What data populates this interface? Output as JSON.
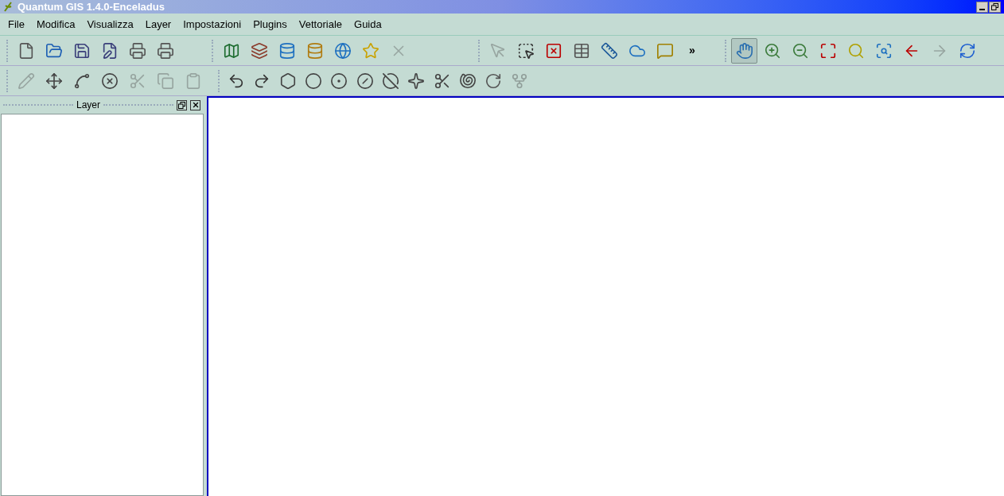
{
  "window": {
    "title": "Quantum GIS 1.4.0-Enceladus"
  },
  "menu": [
    "File",
    "Modifica",
    "Visualizza",
    "Layer",
    "Impostazioni",
    "Plugins",
    "Vettoriale",
    "Guida"
  ],
  "toolbars": [
    {
      "groups": [
        {
          "buttons": [
            {
              "disabled": false,
              "selected": false
            },
            {
              "disabled": false,
              "selected": false
            },
            {
              "disabled": false,
              "selected": false
            },
            {
              "disabled": false,
              "selected": false
            },
            {
              "disabled": false,
              "selected": false
            },
            {
              "disabled": false,
              "selected": false
            }
          ]
        },
        {
          "buttons": [
            {
              "disabled": false,
              "selected": false
            },
            {
              "disabled": false,
              "selected": false
            },
            {
              "disabled": false,
              "selected": false
            },
            {
              "disabled": false,
              "selected": false
            },
            {
              "disabled": false,
              "selected": false
            },
            {
              "disabled": false,
              "selected": false
            },
            {
              "disabled": true,
              "selected": false
            }
          ]
        },
        {
          "buttons": [
            {
              "disabled": true,
              "selected": false
            },
            {
              "disabled": false,
              "selected": false
            },
            {
              "disabled": false,
              "selected": false
            },
            {
              "disabled": false,
              "selected": false
            },
            {
              "disabled": false,
              "selected": false
            },
            {
              "disabled": false,
              "selected": false
            },
            {
              "disabled": false,
              "selected": false
            }
          ],
          "overflow": "»"
        },
        {
          "buttons": [
            {
              "disabled": false,
              "selected": true
            },
            {
              "disabled": false,
              "selected": false
            },
            {
              "disabled": false,
              "selected": false
            },
            {
              "disabled": false,
              "selected": false
            },
            {
              "disabled": false,
              "selected": false
            },
            {
              "disabled": false,
              "selected": false
            },
            {
              "disabled": false,
              "selected": false
            },
            {
              "disabled": true,
              "selected": false
            },
            {
              "disabled": false,
              "selected": false
            }
          ]
        }
      ]
    },
    {
      "groups": [
        {
          "buttons": [
            {
              "disabled": true,
              "selected": false
            },
            {
              "disabled": false,
              "selected": false
            },
            {
              "disabled": false,
              "selected": false
            },
            {
              "disabled": false,
              "selected": false
            },
            {
              "disabled": true,
              "selected": false
            },
            {
              "disabled": true,
              "selected": false
            },
            {
              "disabled": true,
              "selected": false
            }
          ]
        },
        {
          "buttons": [
            {
              "disabled": false,
              "selected": false
            },
            {
              "disabled": false,
              "selected": false
            },
            {
              "disabled": false,
              "selected": false
            },
            {
              "disabled": false,
              "selected": false
            },
            {
              "disabled": false,
              "selected": false
            },
            {
              "disabled": false,
              "selected": false
            },
            {
              "disabled": false,
              "selected": false
            },
            {
              "disabled": false,
              "selected": false
            },
            {
              "disabled": false,
              "selected": false
            },
            {
              "disabled": false,
              "selected": false
            },
            {
              "disabled": false,
              "selected": false
            },
            {
              "disabled": true,
              "selected": false
            }
          ]
        }
      ]
    }
  ],
  "layer_panel": {
    "title": "Layer"
  }
}
